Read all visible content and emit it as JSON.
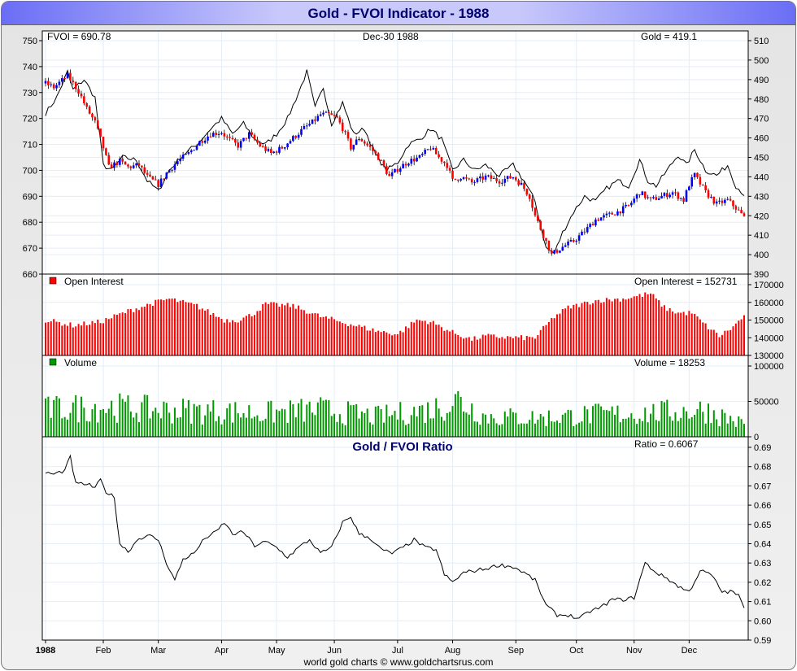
{
  "title": "Gold - FVOI Indicator - 1988",
  "footer": "world gold charts © www.goldchartsrus.com",
  "chart_data": [
    {
      "type": "line",
      "panel": "price",
      "labels": {
        "fvoi": "FVOI = 690.78",
        "date": "Dec-30  1988",
        "gold": "Gold = 419.1"
      },
      "left_axis": {
        "ticks": [
          "750",
          "740",
          "730",
          "720",
          "710",
          "700",
          "690",
          "680",
          "670",
          "660"
        ],
        "range": [
          660,
          750
        ]
      },
      "right_axis": {
        "ticks": [
          "510",
          "500",
          "490",
          "480",
          "470",
          "460",
          "450",
          "440",
          "430",
          "420",
          "410",
          "400",
          "390"
        ],
        "range": [
          390,
          510
        ]
      },
      "gold_series": [
        [
          0,
          488
        ],
        [
          3,
          486
        ],
        [
          8,
          492
        ],
        [
          10,
          488
        ],
        [
          12,
          484
        ],
        [
          15,
          475
        ],
        [
          18,
          468
        ],
        [
          21,
          455
        ],
        [
          23,
          445
        ],
        [
          27,
          448
        ],
        [
          30,
          445
        ],
        [
          34,
          446
        ],
        [
          37,
          440
        ],
        [
          41,
          436
        ],
        [
          44,
          442
        ],
        [
          48,
          448
        ],
        [
          52,
          452
        ],
        [
          56,
          458
        ],
        [
          60,
          462
        ],
        [
          64,
          463
        ],
        [
          66,
          460
        ],
        [
          70,
          456
        ],
        [
          74,
          462
        ],
        [
          78,
          456
        ],
        [
          82,
          452
        ],
        [
          86,
          455
        ],
        [
          90,
          460
        ],
        [
          94,
          465
        ],
        [
          97,
          468
        ],
        [
          100,
          472
        ],
        [
          103,
          472
        ],
        [
          106,
          470
        ],
        [
          108,
          465
        ],
        [
          111,
          455
        ],
        [
          114,
          460
        ],
        [
          118,
          455
        ],
        [
          121,
          450
        ],
        [
          125,
          440
        ],
        [
          128,
          444
        ],
        [
          132,
          448
        ],
        [
          136,
          450
        ],
        [
          140,
          455
        ],
        [
          143,
          450
        ],
        [
          146,
          446
        ],
        [
          148,
          438
        ],
        [
          151,
          440
        ],
        [
          155,
          437
        ],
        [
          160,
          440
        ],
        [
          165,
          438
        ],
        [
          170,
          440
        ],
        [
          173,
          436
        ],
        [
          176,
          430
        ],
        [
          178,
          420
        ],
        [
          181,
          410
        ],
        [
          184,
          400
        ],
        [
          188,
          404
        ],
        [
          192,
          407
        ],
        [
          196,
          412
        ],
        [
          200,
          418
        ],
        [
          204,
          420
        ],
        [
          208,
          422
        ],
        [
          212,
          425
        ],
        [
          216,
          432
        ],
        [
          220,
          428
        ],
        [
          224,
          430
        ],
        [
          228,
          432
        ],
        [
          232,
          428
        ],
        [
          234,
          436
        ],
        [
          236,
          441
        ],
        [
          240,
          432
        ],
        [
          244,
          426
        ],
        [
          248,
          428
        ],
        [
          251,
          424
        ],
        [
          254,
          419.1
        ]
      ],
      "fvoi_series": [
        [
          0,
          722
        ],
        [
          4,
          728
        ],
        [
          8,
          738
        ],
        [
          10,
          731
        ],
        [
          14,
          735
        ],
        [
          18,
          728
        ],
        [
          21,
          702
        ],
        [
          24,
          700
        ],
        [
          28,
          705
        ],
        [
          33,
          704
        ],
        [
          37,
          696
        ],
        [
          41,
          692
        ],
        [
          45,
          700
        ],
        [
          50,
          706
        ],
        [
          55,
          710
        ],
        [
          60,
          716
        ],
        [
          64,
          720
        ],
        [
          68,
          714
        ],
        [
          72,
          718
        ],
        [
          76,
          712
        ],
        [
          80,
          710
        ],
        [
          84,
          714
        ],
        [
          88,
          720
        ],
        [
          92,
          730
        ],
        [
          95,
          738
        ],
        [
          98,
          724
        ],
        [
          101,
          732
        ],
        [
          104,
          718
        ],
        [
          108,
          726
        ],
        [
          112,
          714
        ],
        [
          116,
          716
        ],
        [
          120,
          706
        ],
        [
          124,
          700
        ],
        [
          128,
          703
        ],
        [
          132,
          710
        ],
        [
          136,
          712
        ],
        [
          140,
          716
        ],
        [
          144,
          712
        ],
        [
          148,
          700
        ],
        [
          152,
          704
        ],
        [
          156,
          700
        ],
        [
          160,
          702
        ],
        [
          165,
          698
        ],
        [
          170,
          702
        ],
        [
          174,
          696
        ],
        [
          178,
          688
        ],
        [
          182,
          670
        ],
        [
          185,
          668
        ],
        [
          188,
          676
        ],
        [
          192,
          684
        ],
        [
          196,
          690
        ],
        [
          200,
          688
        ],
        [
          204,
          693
        ],
        [
          208,
          696
        ],
        [
          212,
          694
        ],
        [
          216,
          704
        ],
        [
          219,
          696
        ],
        [
          222,
          694
        ],
        [
          226,
          700
        ],
        [
          230,
          706
        ],
        [
          233,
          702
        ],
        [
          236,
          708
        ],
        [
          240,
          700
        ],
        [
          244,
          698
        ],
        [
          248,
          702
        ],
        [
          251,
          694
        ],
        [
          254,
          690.78
        ]
      ]
    },
    {
      "type": "bar",
      "panel": "open_interest",
      "legend": "Open Interest",
      "value_label": "Open Interest = 152731",
      "color": "#ff0000",
      "axis": {
        "ticks": [
          "170000",
          "160000",
          "150000",
          "140000",
          "130000"
        ],
        "range": [
          130000,
          170000
        ]
      },
      "series_thousands": [
        [
          0,
          150
        ],
        [
          10,
          147
        ],
        [
          20,
          149
        ],
        [
          30,
          155
        ],
        [
          40,
          160
        ],
        [
          45,
          162
        ],
        [
          55,
          158
        ],
        [
          65,
          150
        ],
        [
          70,
          150
        ],
        [
          75,
          153
        ],
        [
          80,
          159
        ],
        [
          90,
          158
        ],
        [
          100,
          152
        ],
        [
          110,
          148
        ],
        [
          120,
          144
        ],
        [
          128,
          142
        ],
        [
          135,
          150
        ],
        [
          140,
          149
        ],
        [
          148,
          143
        ],
        [
          155,
          139
        ],
        [
          160,
          141
        ],
        [
          170,
          140
        ],
        [
          178,
          140
        ],
        [
          185,
          152
        ],
        [
          190,
          157
        ],
        [
          200,
          161
        ],
        [
          210,
          162
        ],
        [
          220,
          165
        ],
        [
          225,
          157
        ],
        [
          230,
          154
        ],
        [
          235,
          154
        ],
        [
          240,
          147
        ],
        [
          245,
          141
        ],
        [
          250,
          146
        ],
        [
          254,
          152.731
        ]
      ]
    },
    {
      "type": "bar",
      "panel": "volume",
      "legend": "Volume",
      "value_label": "Volume = 18253",
      "color": "#009900",
      "axis": {
        "ticks": [
          "100000",
          "50000",
          "0"
        ],
        "range": [
          0,
          100000
        ]
      },
      "series_thousands": [
        [
          0,
          40
        ],
        [
          20,
          45
        ],
        [
          40,
          40
        ],
        [
          60,
          38
        ],
        [
          80,
          35
        ],
        [
          100,
          40
        ],
        [
          120,
          30
        ],
        [
          140,
          40
        ],
        [
          150,
          55
        ],
        [
          160,
          30
        ],
        [
          180,
          28
        ],
        [
          200,
          33
        ],
        [
          220,
          35
        ],
        [
          240,
          40
        ],
        [
          254,
          18.253
        ]
      ]
    },
    {
      "type": "line",
      "panel": "ratio",
      "title": "Gold / FVOI Ratio",
      "value_label": "Ratio = 0.6067",
      "axis": {
        "ticks": [
          "0.69",
          "0.68",
          "0.67",
          "0.66",
          "0.65",
          "0.64",
          "0.63",
          "0.62",
          "0.61",
          "0.60",
          "0.59"
        ],
        "range": [
          0.59,
          0.69
        ]
      },
      "series": [
        [
          0,
          0.677
        ],
        [
          3,
          0.676
        ],
        [
          7,
          0.678
        ],
        [
          9,
          0.685
        ],
        [
          11,
          0.671
        ],
        [
          15,
          0.671
        ],
        [
          18,
          0.669
        ],
        [
          20,
          0.673
        ],
        [
          22,
          0.667
        ],
        [
          25,
          0.664
        ],
        [
          27,
          0.64
        ],
        [
          30,
          0.636
        ],
        [
          34,
          0.643
        ],
        [
          38,
          0.644
        ],
        [
          41,
          0.642
        ],
        [
          44,
          0.63
        ],
        [
          47,
          0.621
        ],
        [
          50,
          0.632
        ],
        [
          54,
          0.635
        ],
        [
          58,
          0.643
        ],
        [
          62,
          0.646
        ],
        [
          65,
          0.651
        ],
        [
          68,
          0.645
        ],
        [
          72,
          0.646
        ],
        [
          76,
          0.639
        ],
        [
          80,
          0.641
        ],
        [
          84,
          0.638
        ],
        [
          88,
          0.633
        ],
        [
          92,
          0.638
        ],
        [
          96,
          0.642
        ],
        [
          100,
          0.635
        ],
        [
          104,
          0.638
        ],
        [
          108,
          0.651
        ],
        [
          111,
          0.654
        ],
        [
          114,
          0.645
        ],
        [
          118,
          0.643
        ],
        [
          122,
          0.637
        ],
        [
          126,
          0.635
        ],
        [
          130,
          0.638
        ],
        [
          134,
          0.642
        ],
        [
          138,
          0.638
        ],
        [
          142,
          0.637
        ],
        [
          145,
          0.624
        ],
        [
          148,
          0.62
        ],
        [
          152,
          0.625
        ],
        [
          156,
          0.626
        ],
        [
          160,
          0.627
        ],
        [
          165,
          0.629
        ],
        [
          170,
          0.628
        ],
        [
          174,
          0.625
        ],
        [
          178,
          0.621
        ],
        [
          182,
          0.608
        ],
        [
          186,
          0.603
        ],
        [
          190,
          0.603
        ],
        [
          194,
          0.601
        ],
        [
          198,
          0.605
        ],
        [
          202,
          0.607
        ],
        [
          206,
          0.611
        ],
        [
          210,
          0.611
        ],
        [
          214,
          0.612
        ],
        [
          218,
          0.63
        ],
        [
          222,
          0.625
        ],
        [
          226,
          0.622
        ],
        [
          230,
          0.618
        ],
        [
          234,
          0.615
        ],
        [
          238,
          0.626
        ],
        [
          242,
          0.624
        ],
        [
          246,
          0.615
        ],
        [
          250,
          0.615
        ],
        [
          252,
          0.613
        ],
        [
          254,
          0.6067
        ]
      ]
    },
    {
      "x_axis": {
        "labels": [
          "1988",
          "Feb",
          "Mar",
          "Apr",
          "May",
          "Jun",
          "Jul",
          "Aug",
          "Sep",
          "Oct",
          "Nov",
          "Dec"
        ],
        "day_index": [
          0,
          21,
          41,
          64,
          84,
          105,
          128,
          148,
          171,
          193,
          214,
          234
        ]
      }
    }
  ],
  "colors": {
    "up": "#0000ff",
    "down": "#ff0000",
    "grid": "#e2eef8"
  }
}
